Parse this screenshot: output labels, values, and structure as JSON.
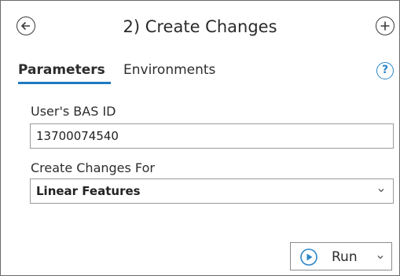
{
  "header": {
    "title": "2) Create Changes",
    "back_icon": "circle-arrow-left-icon",
    "add_icon": "circle-plus-icon"
  },
  "tabs": [
    {
      "label": "Parameters",
      "active": true
    },
    {
      "label": "Environments",
      "active": false
    }
  ],
  "help_icon": "help-icon",
  "fields": {
    "bas_id": {
      "label": "User's BAS ID",
      "value": "13700074540"
    },
    "create_changes_for": {
      "label": "Create Changes For",
      "value": "Linear Features"
    }
  },
  "run_button": {
    "label": "Run",
    "icon": "play-circle-icon"
  },
  "colors": {
    "accent": "#1f7ac1",
    "help": "#2a86c8",
    "border": "#9a9a9a"
  }
}
